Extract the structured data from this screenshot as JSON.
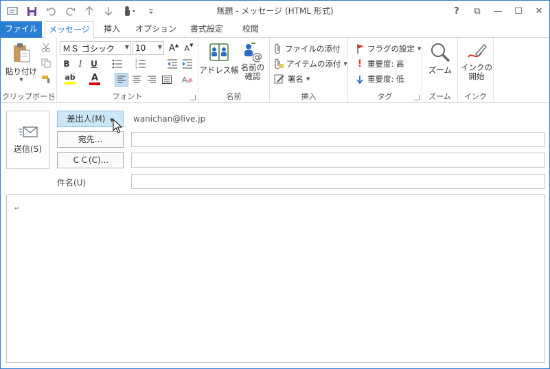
{
  "window": {
    "title": "無題 - メッセージ (HTML 形式)"
  },
  "qat": {
    "icons": [
      "mail-icon",
      "save-icon",
      "undo-icon",
      "redo-icon",
      "up-arrow-icon",
      "down-arrow-icon",
      "touch-mode-icon",
      "customize-icon"
    ]
  },
  "window_controls": {
    "help": "?",
    "restore_ribbon": "⧉",
    "minimize": "—",
    "maximize": "☐",
    "close": "✕"
  },
  "tabs": [
    {
      "label": "ファイル"
    },
    {
      "label": "メッセージ"
    },
    {
      "label": "挿入"
    },
    {
      "label": "オプション"
    },
    {
      "label": "書式設定"
    },
    {
      "label": "校閲"
    }
  ],
  "ribbon": {
    "clipboard": {
      "label": "クリップボード",
      "paste": "貼り付け"
    },
    "font": {
      "label": "フォント",
      "font_name": "ＭＳ ゴシック",
      "font_size": "10",
      "grow": "A",
      "shrink": "A",
      "bold": "B",
      "italic": "I",
      "underline": "U",
      "highlight": "ab",
      "font_color": "A"
    },
    "names": {
      "label": "名前",
      "address_book": "アドレス帳",
      "check_names_1": "名前の",
      "check_names_2": "確認"
    },
    "insert": {
      "label": "挿入",
      "attach_file": "ファイルの添付",
      "attach_item": "アイテムの添付",
      "signature": "署名"
    },
    "tags": {
      "label": "タグ",
      "followup": "フラグの設定",
      "high": "重要度: 高",
      "low": "重要度: 低"
    },
    "zoom": {
      "label": "ズーム",
      "zoom": "ズーム"
    },
    "ink": {
      "label": "インク",
      "start_1": "インクの",
      "start_2": "開始"
    }
  },
  "compose": {
    "send": "送信(S)",
    "from_button": "差出人(M)",
    "from_value": "wanichan@live.jp",
    "to_button": "宛先...",
    "cc_button": "ＣＣ(C)...",
    "subject_label": "件名(U)",
    "body_mark": "↵"
  },
  "colors": {
    "accent": "#2b7cd3",
    "hover_button": "#cde6f7",
    "flag_red": "#d9321f",
    "importance_blue": "#2b6cc4"
  }
}
